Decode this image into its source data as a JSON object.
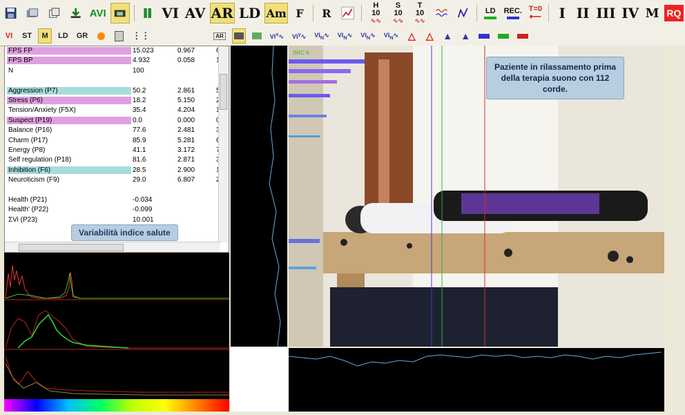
{
  "toolbar": {
    "avi_label": "AVI",
    "vi_label": "VI",
    "av_label": "AV",
    "ar_label": "AR",
    "ld_label": "LD",
    "am_label": "Am",
    "f_label": "F",
    "r_label": "R",
    "h10_label": "H 10",
    "s10_label": "S 10",
    "t10_label": "T 10",
    "ld2_label": "LD",
    "rec_label": "REC.",
    "t0_label": "T=0",
    "i_label": "I",
    "ii_label": "II",
    "iii_label": "III",
    "iv_label": "IV",
    "m_label": "M",
    "rq_label": "RQ"
  },
  "toolbar2": {
    "vi_label": "VI",
    "st_label": "ST",
    "m_label": "M",
    "ld_label": "LD",
    "gr_label": "GR",
    "ar_small": "AR"
  },
  "table": {
    "rows": [
      {
        "name": "FPS FP",
        "v1": "15.023",
        "v2": "0.967",
        "v3": "6"
      },
      {
        "name": "FPS BP",
        "v1": "4.932",
        "v2": "0.058",
        "v3": "1"
      },
      {
        "name": "N",
        "v1": "100",
        "v2": "",
        "v3": ""
      },
      {
        "name": "",
        "v1": "",
        "v2": "",
        "v3": ""
      },
      {
        "name": "Aggression (P7)",
        "v1": "50.2",
        "v2": "2.861",
        "v3": "5"
      },
      {
        "name": "Stress (P6)",
        "v1": "18.2",
        "v2": "5.150",
        "v3": "2("
      },
      {
        "name": "Tension/Anxiety (F5X)",
        "v1": "35.4",
        "v2": "4.204",
        "v3": "1"
      },
      {
        "name": "Suspect (P19)",
        "v1": "0.0",
        "v2": "0.000",
        "v3": "0"
      },
      {
        "name": "Balance (P16)",
        "v1": "77.6",
        "v2": "2.481",
        "v3": "3"
      },
      {
        "name": "Charm (P17)",
        "v1": "85.9",
        "v2": "5.281",
        "v3": "6"
      },
      {
        "name": "Energy (P8)",
        "v1": "41.1",
        "v2": "3.172",
        "v3": "7"
      },
      {
        "name": "Self regulation (P18)",
        "v1": "81.6",
        "v2": "2.871",
        "v3": "3"
      },
      {
        "name": "Inhibition (F6)",
        "v1": "28.5",
        "v2": "2.900",
        "v3": "1("
      },
      {
        "name": "Neuroticism (F9)",
        "v1": "29.0",
        "v2": "6.807",
        "v3": "2:"
      },
      {
        "name": "",
        "v1": "",
        "v2": "",
        "v3": ""
      },
      {
        "name": "Health (P21)",
        "v1": "-0.034",
        "v2": "",
        "v3": ""
      },
      {
        "name": "Health' (P22)",
        "v1": "-0.099",
        "v2": "",
        "v3": ""
      },
      {
        "name": "ΣVi (P23)",
        "v1": "10.001",
        "v2": "",
        "v3": ""
      }
    ],
    "highlight_pink": "#e0a0e0",
    "highlight_cyan": "#a8dcdc"
  },
  "health_badge": "Variabilità indice salute",
  "video": {
    "src_label": "SRC A",
    "caption": "Paziente in rilassamento prima della terapia suono con 112 corde."
  },
  "colors": {
    "accent_yellow": "#f1e07a",
    "rq_red": "#e22222",
    "badge_blue": "#b7cde0"
  }
}
